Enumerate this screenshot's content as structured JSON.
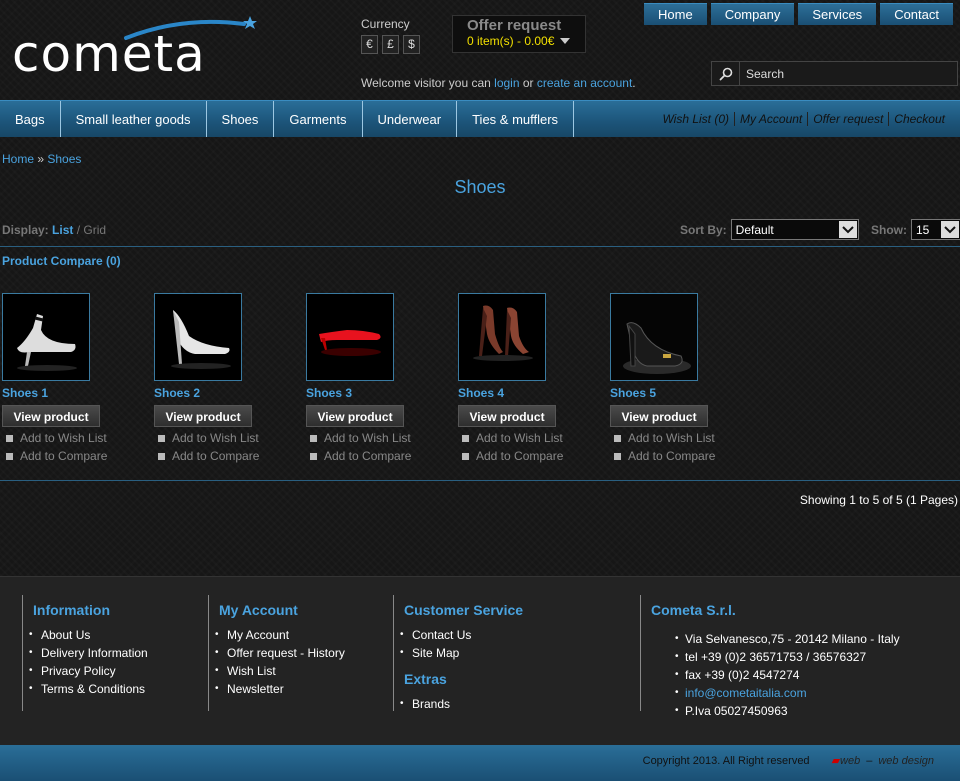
{
  "logo": {
    "text": "cometa"
  },
  "currency": {
    "label": "Currency",
    "options": [
      "€",
      "£",
      "$"
    ]
  },
  "offer": {
    "title": "Offer request",
    "items": "0 item(s) - 0.00€"
  },
  "welcome": {
    "prefix": "Welcome visitor you can ",
    "login": "login",
    "or": " or ",
    "create": "create an account",
    "suffix": "."
  },
  "top_nav": [
    "Home",
    "Company",
    "Services",
    "Contact"
  ],
  "search": {
    "placeholder": "Search"
  },
  "categories": [
    "Bags",
    "Small leather goods",
    "Shoes",
    "Garments",
    "Underwear",
    "Ties & mufflers"
  ],
  "account_links": [
    "Wish List (0)",
    "My Account",
    "Offer request",
    "Checkout"
  ],
  "breadcrumb": {
    "home": "Home",
    "sep": " » ",
    "current": "Shoes"
  },
  "page_title": "Shoes",
  "display": {
    "label": "Display:",
    "list": "List",
    "sep": " / ",
    "grid": "Grid"
  },
  "sort": {
    "label": "Sort By:",
    "value": "Default"
  },
  "show": {
    "label": "Show:",
    "value": "15"
  },
  "compare": "Product Compare (0)",
  "products": [
    {
      "name": "Shoes 1",
      "view": "View product",
      "wish": "Add to Wish List",
      "compare": "Add to Compare"
    },
    {
      "name": "Shoes 2",
      "view": "View product",
      "wish": "Add to Wish List",
      "compare": "Add to Compare"
    },
    {
      "name": "Shoes 3",
      "view": "View product",
      "wish": "Add to Wish List",
      "compare": "Add to Compare"
    },
    {
      "name": "Shoes 4",
      "view": "View product",
      "wish": "Add to Wish List",
      "compare": "Add to Compare"
    },
    {
      "name": "Shoes 5",
      "view": "View product",
      "wish": "Add to Wish List",
      "compare": "Add to Compare"
    }
  ],
  "showing": "Showing 1 to 5 of 5 (1 Pages)",
  "footer": {
    "information": {
      "title": "Information",
      "items": [
        "About Us",
        "Delivery Information",
        "Privacy Policy",
        "Terms & Conditions"
      ]
    },
    "my_account": {
      "title": "My Account",
      "items": [
        "My Account",
        "Offer request - History",
        "Wish List",
        "Newsletter"
      ]
    },
    "customer_service": {
      "title": "Customer Service",
      "items": [
        "Contact Us",
        "Site Map"
      ]
    },
    "extras": {
      "title": "Extras",
      "items": [
        "Brands"
      ]
    },
    "company": {
      "title": "Cometa S.r.l.",
      "address": "Via Selvanesco,75 - 20142 Milano - Italy",
      "tel": "tel  +39 (0)2 36571753 / 36576327",
      "fax": "fax +39 (0)2 4547274",
      "email": "info@cometaitalia.com",
      "vat": "P.Iva 05027450963"
    }
  },
  "copyright": {
    "text": "Copyright 2013. All Right reserved",
    "maker_mark": "web",
    "maker_sep": "–",
    "maker_label": "web design"
  },
  "colors": {
    "accent": "#4aa3df",
    "nav_blue": "#1c5479",
    "offer_yellow": "#f2e000",
    "background": "#161616"
  }
}
